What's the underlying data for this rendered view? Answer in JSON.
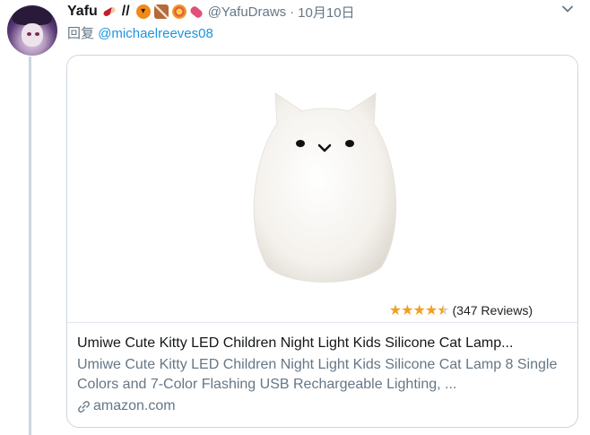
{
  "tweet": {
    "author_name": "Yafu",
    "name_suffix_slashes": "//",
    "emojis": [
      "pencil-emoji",
      "pumpkin-emoji",
      "chocolate-emoji",
      "lollipop-emoji",
      "candy-emoji"
    ],
    "handle": "@YafuDraws",
    "separator": "·",
    "timestamp": "10月10日",
    "reply_prefix": "回复",
    "reply_mention": "@michaelreeves08"
  },
  "card": {
    "rating_stars": "★★★★★",
    "review_count": "(347 Reviews)",
    "title": "Umiwe Cute Kitty LED Children Night Light Kids Silicone Cat Lamp...",
    "description": "Umiwe Cute Kitty LED Children Night Light Kids Silicone Cat Lamp 8 Single Colors and 7-Color Flashing USB Rechargeable Lighting, ...",
    "domain": "amazon.com",
    "rating_value": 4.5
  },
  "colors": {
    "link": "#1b95e0",
    "secondary_text": "#657786",
    "border": "#ccd6dd",
    "star": "#f0a020"
  },
  "icons": {
    "more": "chevron-down-icon",
    "link": "link-icon"
  }
}
